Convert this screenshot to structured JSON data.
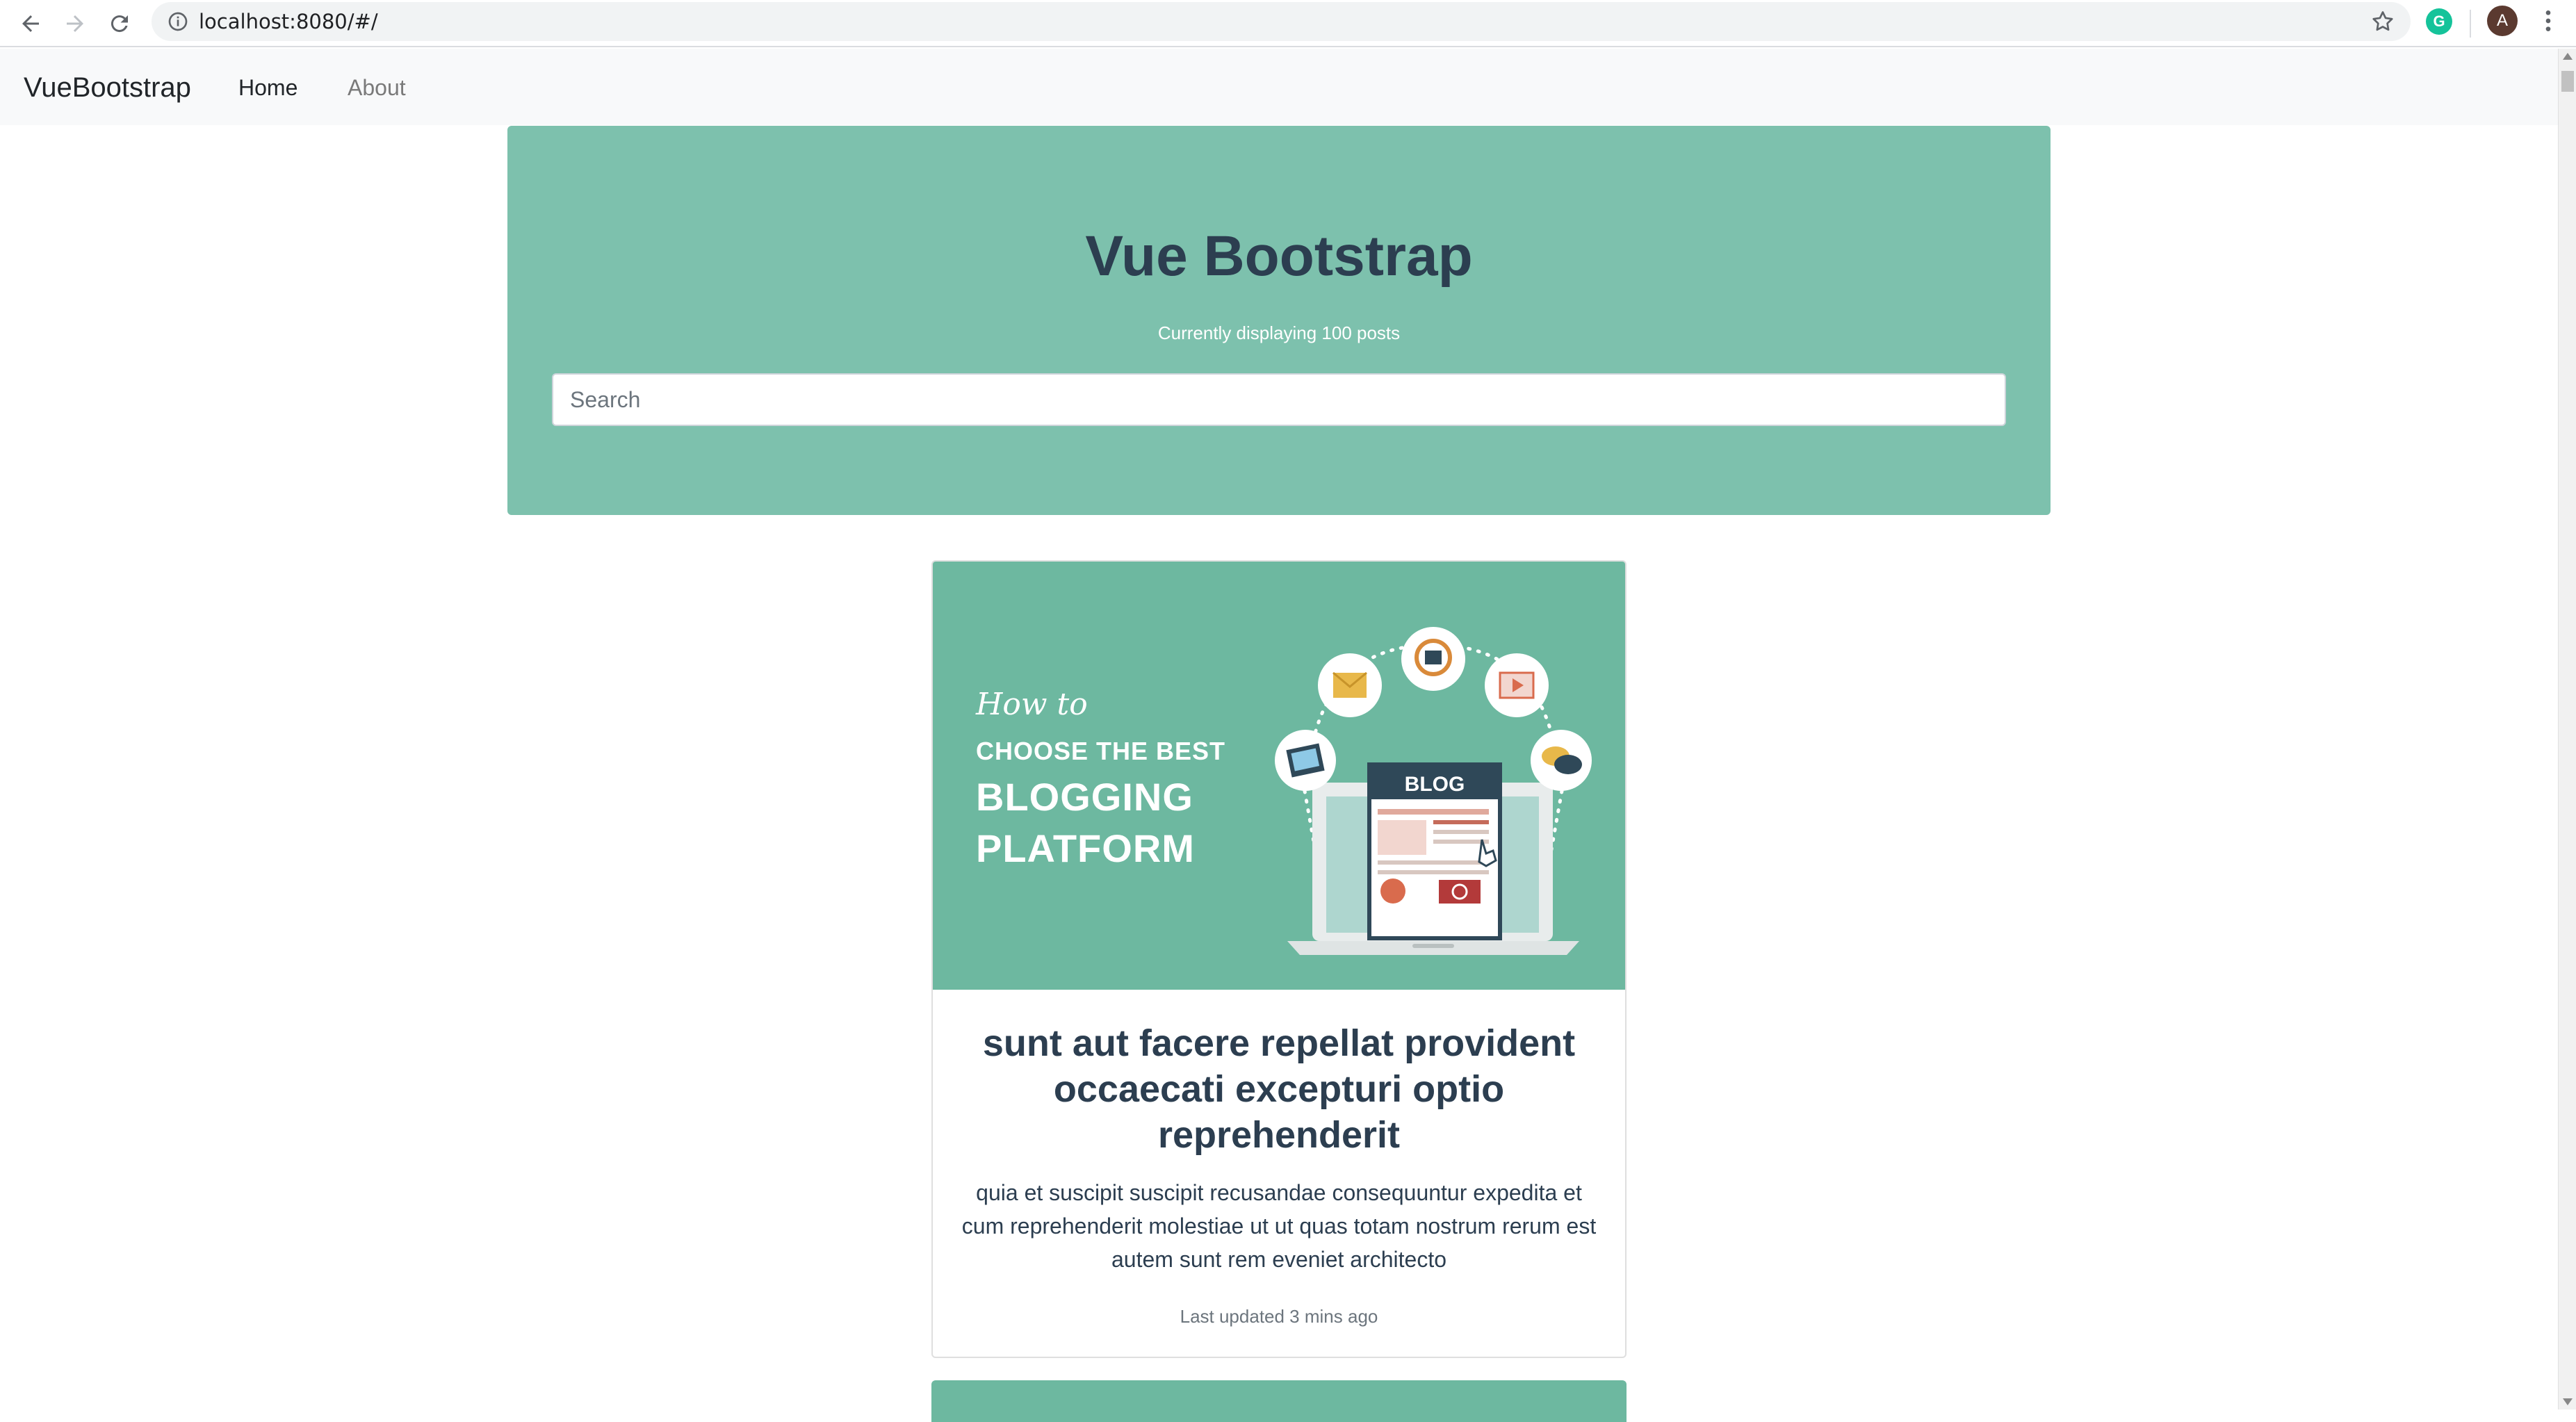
{
  "browser": {
    "url": "localhost:8080/#/",
    "avatar_letter": "A",
    "extension_letter": "G"
  },
  "navbar": {
    "brand": "VueBootstrap",
    "links": [
      {
        "label": "Home",
        "active": true
      },
      {
        "label": "About",
        "active": false
      }
    ]
  },
  "jumbotron": {
    "title": "Vue Bootstrap",
    "subtitle": "Currently displaying 100 posts",
    "search_placeholder": "Search",
    "background": "#7dc1ad"
  },
  "posts": [
    {
      "image": {
        "line1": "How to",
        "line2": "CHOOSE THE BEST",
        "line3": "BLOGGING",
        "line4": "PLATFORM",
        "screen_label": "BLOG"
      },
      "title": "sunt aut facere repellat provident occaecati excepturi optio reprehenderit",
      "body": "quia et suscipit suscipit recusandae consequuntur expedita et cum reprehenderit molestiae ut ut quas totam nostrum rerum est autem sunt rem eveniet architecto",
      "footer": "Last updated 3 mins ago"
    }
  ],
  "colors": {
    "accent": "#7dc1ad",
    "card_image_bg": "#6db8a0",
    "text_dark": "#2c3e50"
  }
}
